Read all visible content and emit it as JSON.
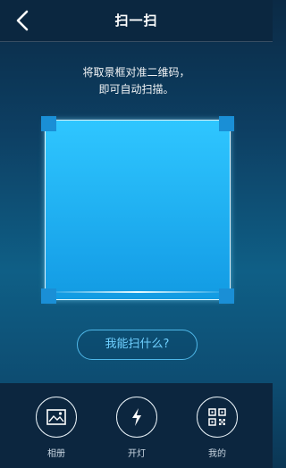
{
  "header": {
    "title": "扫一扫"
  },
  "hint": {
    "line1": "将取景框对准二维码，",
    "line2": "即可自动扫描。"
  },
  "ask_button": {
    "label": "我能扫什么?"
  },
  "toolbar": {
    "items": [
      {
        "label": "相册",
        "icon": "image-icon"
      },
      {
        "label": "开灯",
        "icon": "flash-icon"
      },
      {
        "label": "我的",
        "icon": "qr-code-icon"
      }
    ]
  },
  "colors": {
    "accent": "#1a8fd6",
    "scan_fill": "#22b3f3",
    "button_text": "#6fd0ff"
  }
}
